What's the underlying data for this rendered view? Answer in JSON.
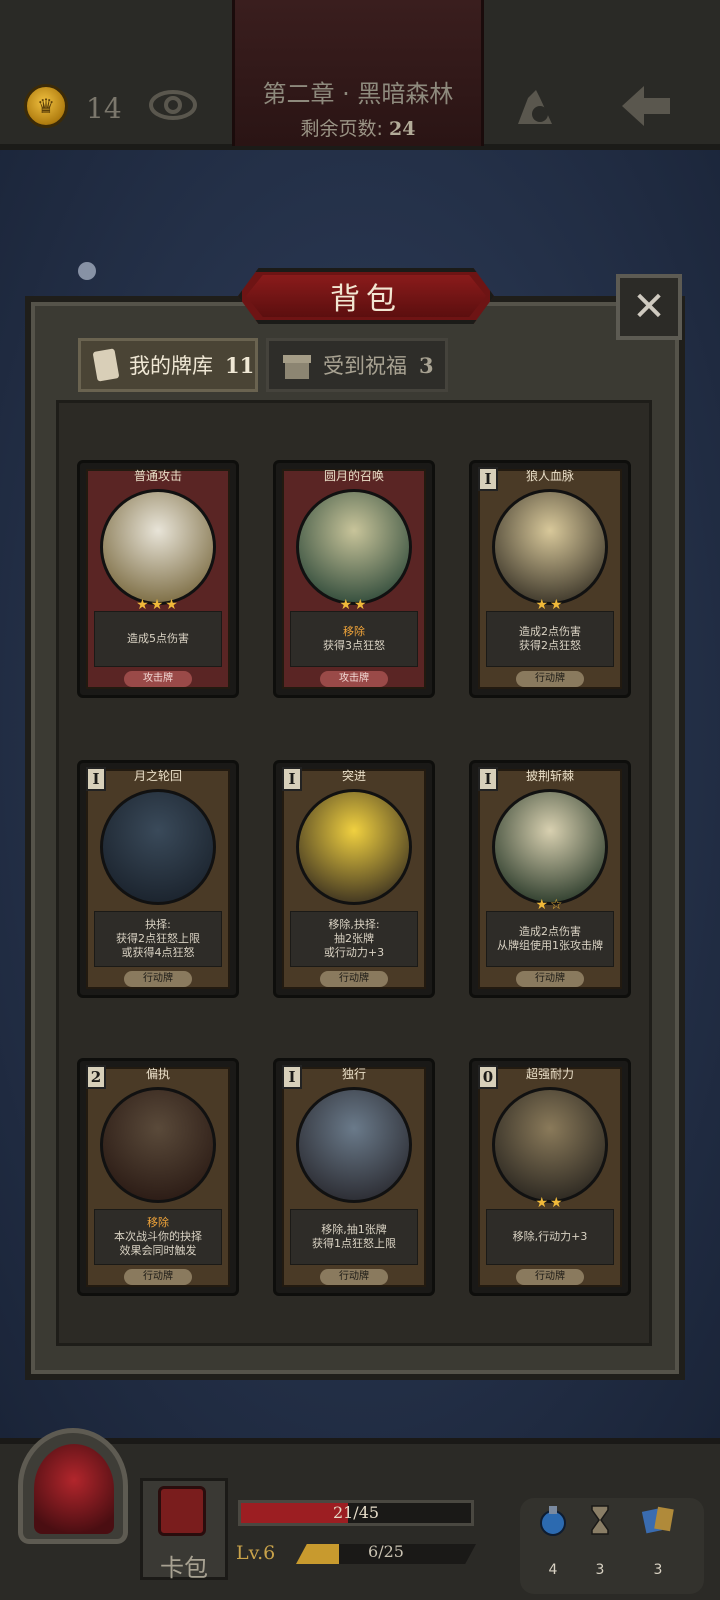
{
  "header": {
    "coins": "14",
    "chapter_title": "第二章 · 黑暗森林",
    "pages_left_label": "剩余页数:",
    "pages_left_value": "24"
  },
  "panel": {
    "title": "背包",
    "close_symbol": "✕"
  },
  "tabs": [
    {
      "label": "我的牌库",
      "count": "11",
      "icon": "card-icon"
    },
    {
      "label": "受到祝福",
      "count": "3",
      "icon": "gift-icon"
    }
  ],
  "cards": [
    {
      "title": "普通攻击",
      "cost": "",
      "stars": "★★★",
      "desc": [
        "造成5点伤害"
      ],
      "type": "攻击牌",
      "kind": "attack"
    },
    {
      "title": "圆月的召唤",
      "cost": "",
      "stars": "★★",
      "desc": [
        "移除",
        "获得3点狂怒"
      ],
      "type": "攻击牌",
      "kind": "attack"
    },
    {
      "title": "狼人血脉",
      "cost": "I",
      "stars": "★★",
      "desc": [
        "造成2点伤害",
        "获得2点狂怒"
      ],
      "type": "行动牌",
      "kind": "action"
    },
    {
      "title": "月之轮回",
      "cost": "I",
      "stars": "",
      "desc": [
        "抉择:",
        "获得2点狂怒上限",
        "或获得4点狂怒"
      ],
      "type": "行动牌",
      "kind": "action"
    },
    {
      "title": "突进",
      "cost": "I",
      "stars": "",
      "desc": [
        "移除,抉择:",
        "抽2张牌",
        "或行动力+3"
      ],
      "type": "行动牌",
      "kind": "action"
    },
    {
      "title": "披荆斩棘",
      "cost": "I",
      "stars": "★☆",
      "desc": [
        "造成2点伤害",
        "从牌组使用1张攻击牌"
      ],
      "type": "行动牌",
      "kind": "action"
    },
    {
      "title": "偏执",
      "cost": "2",
      "stars": "",
      "desc": [
        "移除",
        "本次战斗你的抉择",
        "效果会同时触发"
      ],
      "type": "行动牌",
      "kind": "action"
    },
    {
      "title": "独行",
      "cost": "I",
      "stars": "",
      "desc": [
        "移除,抽1张牌",
        "获得1点狂怒上限"
      ],
      "type": "行动牌",
      "kind": "action"
    },
    {
      "title": "超强耐力",
      "cost": "0",
      "stars": "★★",
      "desc": [
        "移除,行动力+3"
      ],
      "type": "行动牌",
      "kind": "action"
    }
  ],
  "bottom": {
    "backpack_label": "卡包",
    "hp_text": "21/45",
    "hp_fraction": 0.467,
    "level": "Lv.6",
    "xp_text": "6/25",
    "xp_fraction": 0.24,
    "resources": [
      {
        "icon": "potion-flask-icon",
        "count": "4"
      },
      {
        "icon": "hourglass-icon",
        "count": "3"
      },
      {
        "icon": "cards-icon",
        "count": "3"
      }
    ]
  },
  "colors": {
    "highlight": "#f0a43a",
    "star": "#f0b93a",
    "attack_frame": "#5a2524",
    "action_frame": "#4a3a26"
  }
}
